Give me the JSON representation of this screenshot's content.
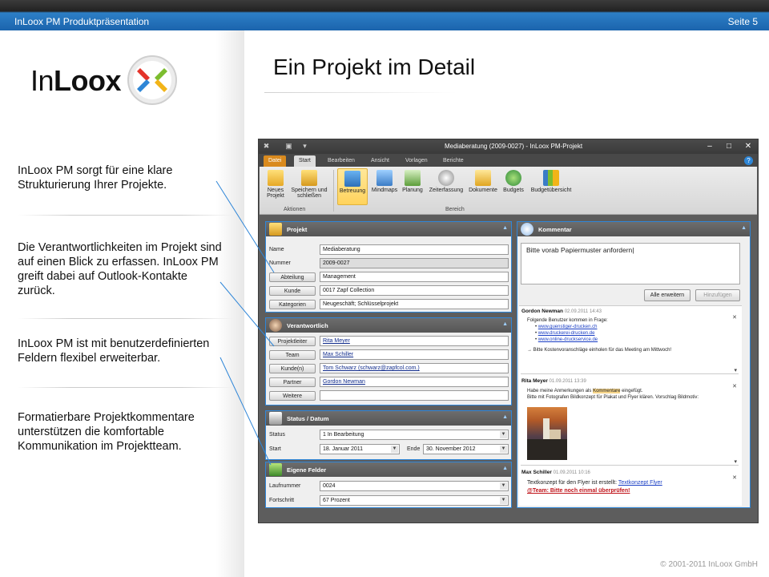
{
  "header": {
    "left": "InLoox PM Produktpräsentation",
    "right": "Seite 5"
  },
  "logo": {
    "text_light": "In",
    "text_bold": "Loox"
  },
  "slide_title": "Ein Projekt im Detail",
  "bullets": [
    "InLoox PM sorgt für eine klare Strukturierung Ihrer Projekte.",
    "Die Verantwortlichkeiten im Projekt sind auf einen Blick zu erfassen. InLoox PM greift dabei auf Outlook-Kontakte zurück.",
    "InLoox PM ist mit benutzerdefinierten Feldern flexibel erweiterbar.",
    "Formatierbare Projektkommentare unterstützen die komfortable Kommunikation im Projektteam."
  ],
  "footer": "© 2001-2011 InLoox GmbH",
  "app": {
    "window_title": "Mediaberatung (2009-0027) - InLoox PM-Projekt",
    "tabs": [
      "Datei",
      "Start",
      "Bearbeiten",
      "Ansicht",
      "Vorlagen",
      "Berichte"
    ],
    "ribbon": {
      "group1": "Aktionen",
      "group2": "Bereich",
      "buttons": [
        "Neues Projekt",
        "Speichern und schließen",
        "Betreuung",
        "Mindmaps",
        "Planung",
        "Zeiterfassung",
        "Dokumente",
        "Budgets",
        "Budgetübersicht"
      ]
    },
    "projekt": {
      "title": "Projekt",
      "name_label": "Name",
      "name": "Mediaberatung",
      "nummer_label": "Nummer",
      "nummer": "2009-0027",
      "abteilung_label": "Abteilung",
      "abteilung": "Management",
      "kunde_label": "Kunde",
      "kunde": "0017 Zapf Collection",
      "kategorien_label": "Kategorien",
      "kategorien": "Neugeschäft; Schlüsselprojekt"
    },
    "verantwortlich": {
      "title": "Verantwortlich",
      "projektleiter_label": "Projektleiter",
      "projektleiter": "Rita Meyer",
      "team_label": "Team",
      "team": "Max Schiller",
      "kunden_label": "Kunde(n)",
      "kunden": "Tom Schwarz (schwarz@zapfcol.com.)",
      "partner_label": "Partner",
      "partner": "Gordon Newman",
      "weitere_label": "Weitere",
      "weitere": ""
    },
    "status": {
      "title": "Status / Datum",
      "status_label": "Status",
      "status": "1 In Bearbeitung",
      "start_label": "Start",
      "start": "18. Januar 2011",
      "ende_label": "Ende",
      "ende": "30. November 2012"
    },
    "eigene": {
      "title": "Eigene Felder",
      "lauf_label": "Laufnummer",
      "lauf": "0024",
      "fort_label": "Fortschritt",
      "fort": "67 Prozent"
    },
    "kommentar": {
      "title": "Kommentar",
      "input": "Bitte vorab Papiermuster anfordern",
      "expand_all": "Alle erweitern",
      "add": "Hinzufügen",
      "c1_author": "Gordon Newman",
      "c1_date": "02.09.2011 14:43",
      "c1_text": "Folgende Benutzer kommen in Frage:",
      "c1_links": [
        "www.guenstiger-drucken.ch",
        "www.druckerei-drucken.de",
        "www.online-druckservice.de"
      ],
      "c1_note": "→ Bitte Kostenvoranschläge einholen für das Meeting am Mittwoch!",
      "c2_author": "Rita Meyer",
      "c2_date": "01.09.2011 13:39",
      "c2_text_a": "Habe meine Anmerkungen als",
      "c2_text_hl": "Kommentare",
      "c2_text_b": "eingefügt.",
      "c2_text2": "Bitte mit Fotografen Bildkonzept für Plakat und Flyer klären. Vorschlag Bildmotiv:",
      "c3_author": "Max Schiller",
      "c3_date": "01.09.2011 10:16",
      "c3_text_a": "Textkonzept für den Flyer ist erstellt:",
      "c3_link": "Textkonzept Flyer",
      "c3_red": "@Team: Bitte noch einmal überprüfen!"
    }
  },
  "colors": {
    "accent": "#1b64ad",
    "callout_line": "#2f86d8",
    "file_tab": "#d98a1e"
  }
}
